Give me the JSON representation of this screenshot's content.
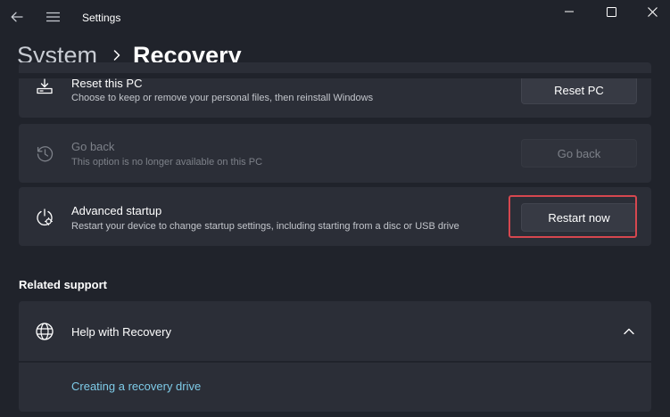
{
  "window": {
    "title": "Settings"
  },
  "breadcrumb": {
    "parent": "System",
    "current": "Recovery"
  },
  "recovery_options": [
    {
      "title": "Reset this PC",
      "description": "Choose to keep or remove your personal files, then reinstall Windows",
      "button": "Reset PC",
      "icon": "reset-pc-icon",
      "enabled": true
    },
    {
      "title": "Go back",
      "description": "This option is no longer available on this PC",
      "button": "Go back",
      "icon": "history-icon",
      "enabled": false
    },
    {
      "title": "Advanced startup",
      "description": "Restart your device to change startup settings, including starting from a disc or USB drive",
      "button": "Restart now",
      "icon": "advanced-startup-icon",
      "enabled": true,
      "highlighted": true
    }
  ],
  "related_support": {
    "heading": "Related support",
    "items": [
      {
        "title": "Help with Recovery",
        "icon": "globe-icon",
        "expanded": true,
        "links": [
          "Creating a recovery drive"
        ]
      }
    ]
  },
  "colors": {
    "background": "#20232b",
    "card": "#2b2e37",
    "button": "#373a44",
    "highlight_border": "#d6474f",
    "link": "#7ecbe8"
  }
}
